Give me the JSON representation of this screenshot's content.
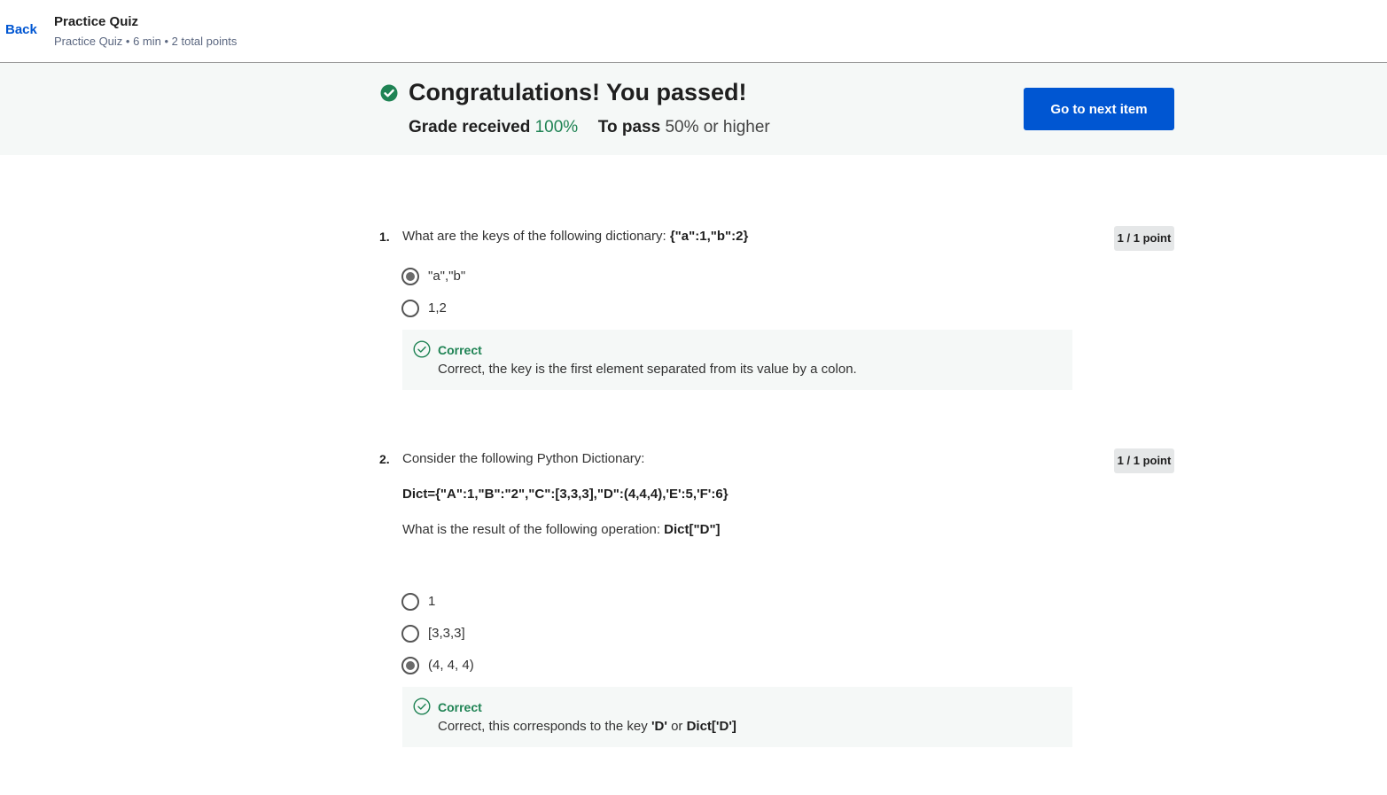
{
  "header": {
    "back_label": "Back",
    "title": "Practice Quiz",
    "subtitle": "Practice Quiz • 6 min • 2 total points"
  },
  "banner": {
    "title": "Congratulations! You passed!",
    "grade_label": "Grade received",
    "grade_value": "100%",
    "pass_label": "To pass",
    "pass_value": "50% or higher",
    "next_button": "Go to next item"
  },
  "questions": [
    {
      "number": "1.",
      "text": "What are the keys of the following dictionary: ",
      "text_code": "{\"a\":1,\"b\":2}",
      "points": "1 / 1 point",
      "options": [
        {
          "label": "\"a\",\"b\"",
          "selected": true
        },
        {
          "label": "1,2",
          "selected": false
        }
      ],
      "feedback": {
        "status": "Correct",
        "text": "Correct, the key is the first element  separated from its value by a colon."
      }
    },
    {
      "number": "2.",
      "text": "Consider the following Python Dictionary:",
      "code_line": "Dict={\"A\":1,\"B\":\"2\",\"C\":[3,3,3],\"D\":(4,4,4),'E':5,'F':6}",
      "prompt": "What is the result of the following operation: ",
      "prompt_code": "Dict[\"D\"]",
      "points": "1 / 1 point",
      "options": [
        {
          "label": "1",
          "selected": false
        },
        {
          "label": "[3,3,3]",
          "selected": false
        },
        {
          "label": "(4, 4, 4)",
          "selected": true
        }
      ],
      "feedback": {
        "status": "Correct",
        "text_prefix": "Correct, this corresponds to the key ",
        "key1": "'D'",
        "or": " or ",
        "key2": "Dict['D']"
      }
    }
  ],
  "colors": {
    "brand_blue": "#0056d2",
    "success_green": "#1f8354",
    "banner_bg": "#f5f8f7"
  }
}
